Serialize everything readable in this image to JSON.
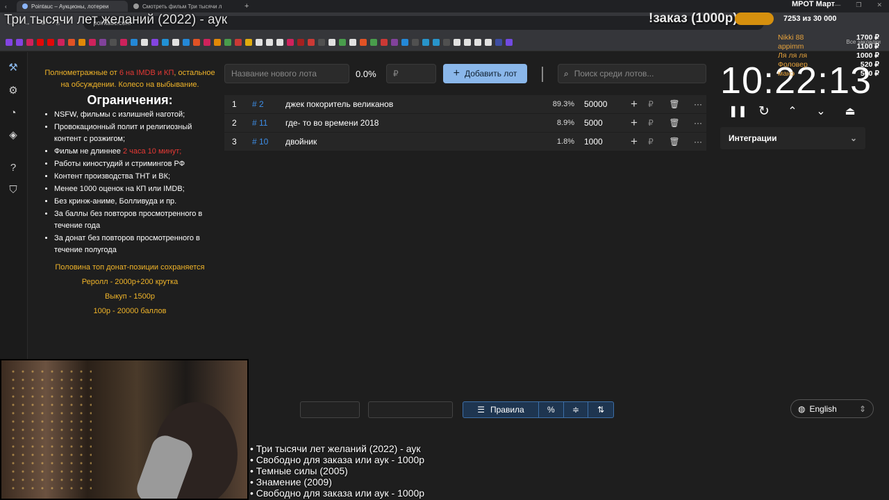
{
  "browser": {
    "tabs": [
      {
        "label": "Pointauc – Аукционы, лотереи"
      },
      {
        "label": "Смотреть фильм Три тысячи л"
      }
    ],
    "url": "pointauc.com",
    "bookmarks_all": "Все закладки"
  },
  "overlay": {
    "stream_title": "Три тысячи лет желаний (2022) - аук",
    "order_label": "!заказ (1000р)",
    "goal_label": "МРОТ Март",
    "goal_count": "7253  из 30 000",
    "donors": [
      "Nikki 88",
      "appimm",
      "Ля ля ля",
      "Фоловер",
      "манэ"
    ],
    "amounts": [
      "1700 ₽",
      "1100 ₽",
      "1000 ₽",
      "520 ₽",
      "500 ₽"
    ],
    "ticker": [
      "• Три тысячи лет желаний (2022) - аук",
      "• Свободно для заказа или аук - 1000р",
      "• Темные силы (2005)",
      "• Знамение (2009)",
      "• Свободно для заказа или аук - 1000р"
    ]
  },
  "rules": {
    "intro_a": "Полнометражные от ",
    "intro_red": "6 на IMDB и КП",
    "intro_b": ", остальное на обсуждении. Колесо на выбывание.",
    "heading": "Ограничения:",
    "items": [
      "NSFW, фильмы с излишней наготой;",
      "Провокационный полит и религиозный контент с розжигом;",
      "Работы киностудий и стримингов РФ",
      "Контент производства ТНТ и ВК;",
      "Менее 1000 оценок на КП или IMDB;",
      "Без кринж-аниме, Болливуда и пр.",
      "За баллы без повторов просмотренного в течение года",
      "За донат без повторов просмотренного в течение полугода"
    ],
    "film_len_a": "Фильм не длиннее ",
    "film_len_red": "2 часа 10 минут;",
    "bottom": [
      "Половина топ донат-позиции сохраняется",
      "Реролл - 2000р+200 крутка",
      "Выкуп - 1500р",
      "100р - 20000 баллов"
    ]
  },
  "controls": {
    "new_lot_placeholder": "Название нового лота",
    "percent": "0.0%",
    "amount_placeholder": "₽",
    "add_button": "Добавить лот",
    "search_placeholder": "Поиск среди лотов..."
  },
  "lots": [
    {
      "n": "1",
      "id": "# 2",
      "name": "джек покоритель великанов",
      "pct": "89.3%",
      "amount": "50000",
      "pct_value": 89.3
    },
    {
      "n": "2",
      "id": "# 11",
      "name": "где- то во времени 2018",
      "pct": "8.9%",
      "amount": "5000",
      "pct_value": 8.9
    },
    {
      "n": "3",
      "id": "# 10",
      "name": "двойник",
      "pct": "1.8%",
      "amount": "1000",
      "pct_value": 1.8
    }
  ],
  "timer": "10:22:13",
  "integrations": "Интеграции",
  "bottom_bar": {
    "rules_button": "Правила"
  },
  "language": "English",
  "colors": {
    "accent": "#8ab7ea",
    "id": "#3d8ee8",
    "highlight": "#f0b429",
    "warning": "#e53935"
  }
}
